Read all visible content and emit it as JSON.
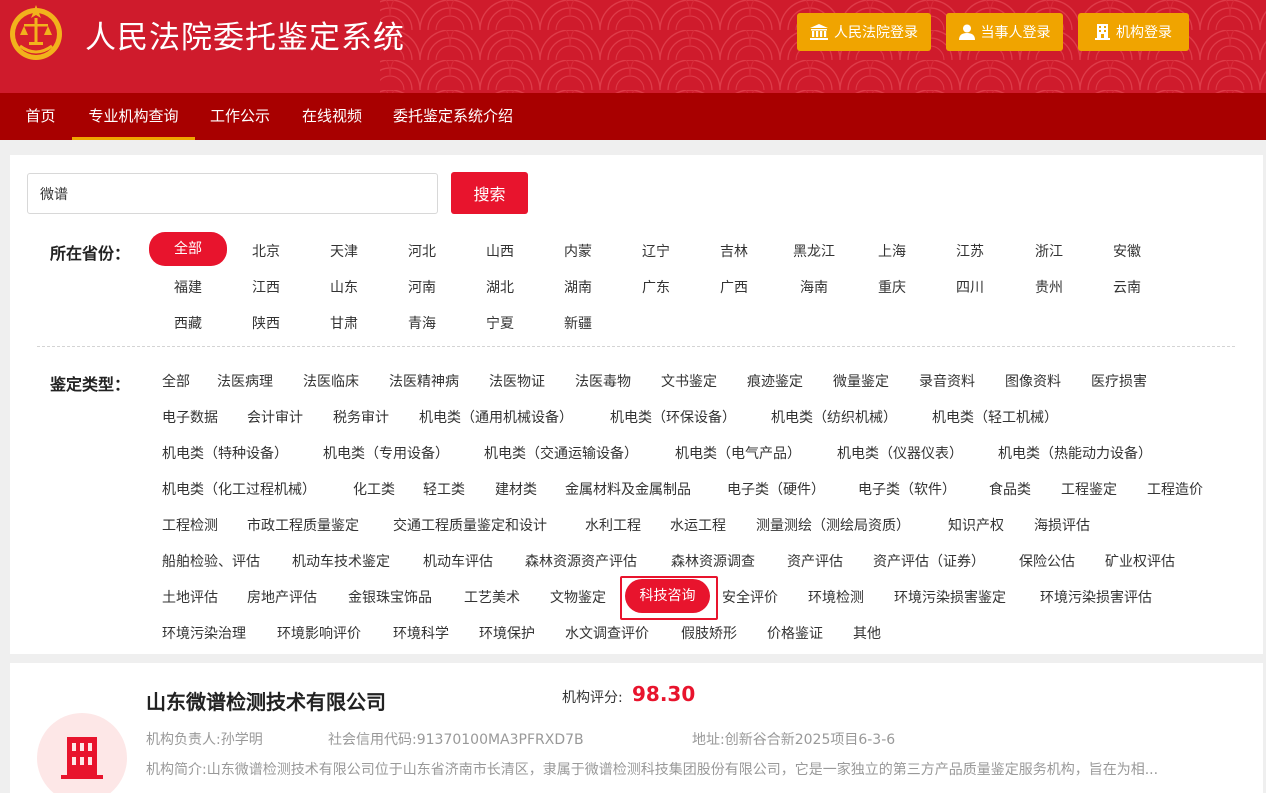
{
  "header": {
    "title": "人民法院委托鉴定系统",
    "buttons": [
      {
        "label": "人民法院登录",
        "icon": "court-building-icon"
      },
      {
        "label": "当事人登录",
        "icon": "person-icon"
      },
      {
        "label": "机构登录",
        "icon": "institution-building-icon"
      }
    ]
  },
  "nav": {
    "items": [
      "首页",
      "专业机构查询",
      "工作公示",
      "在线视频",
      "委托鉴定系统介绍"
    ],
    "active": "专业机构查询"
  },
  "search": {
    "value": "微谱",
    "button_label": "搜索"
  },
  "filters": {
    "province_label": "所在省份：",
    "provinces": [
      [
        "全部",
        "北京",
        "天津",
        "河北",
        "山西",
        "内蒙",
        "辽宁",
        "吉林",
        "黑龙江",
        "上海",
        "江苏",
        "浙江",
        "安徽"
      ],
      [
        "福建",
        "江西",
        "山东",
        "河南",
        "湖北",
        "湖南",
        "广东",
        "广西",
        "海南",
        "重庆",
        "四川",
        "贵州",
        "云南"
      ],
      [
        "西藏",
        "陕西",
        "甘肃",
        "青海",
        "宁夏",
        "新疆"
      ]
    ],
    "province_selected": "全部",
    "type_label": "鉴定类型：",
    "types": [
      [
        "全部",
        "法医病理",
        "法医临床",
        "法医精神病",
        "法医物证",
        "法医毒物",
        "文书鉴定",
        "痕迹鉴定",
        "微量鉴定",
        "录音资料",
        "图像资料",
        "医疗损害"
      ],
      [
        "电子数据",
        "会计审计",
        "税务审计",
        "机电类（通用机械设备）",
        "机电类（环保设备）",
        "机电类（纺织机械）",
        "机电类（轻工机械）"
      ],
      [
        "机电类（特种设备）",
        "机电类（专用设备）",
        "机电类（交通运输设备）",
        "机电类（电气产品）",
        "机电类（仪器仪表）",
        "机电类（热能动力设备）"
      ],
      [
        "机电类（化工过程机械）",
        "化工类",
        "轻工类",
        "建材类",
        "金属材料及金属制品",
        "电子类（硬件）",
        "电子类（软件）",
        "食品类",
        "工程鉴定",
        "工程造价"
      ],
      [
        "工程检测",
        "市政工程质量鉴定",
        "交通工程质量鉴定和设计",
        "水利工程",
        "水运工程",
        "测量测绘（测绘局资质）",
        "知识产权",
        "海损评估"
      ],
      [
        "船舶检验、评估",
        "机动车技术鉴定",
        "机动车评估",
        "森林资源资产评估",
        "森林资源调查",
        "资产评估",
        "资产评估（证券）",
        "保险公估",
        "矿业权评估"
      ],
      [
        "土地评估",
        "房地产评估",
        "金银珠宝饰品",
        "工艺美术",
        "文物鉴定",
        "科技咨询",
        "安全评价",
        "环境检测",
        "环境污染损害鉴定",
        "环境污染损害评估"
      ],
      [
        "环境污染治理",
        "环境影响评价",
        "环境科学",
        "环境保护",
        "水文调查评价",
        "假肢矫形",
        "价格鉴证",
        "其他"
      ]
    ],
    "type_selected": "科技咨询"
  },
  "result": {
    "name": "山东微谱检测技术有限公司",
    "score_label": "机构评分:",
    "score": "98.30",
    "leader": "机构负责人:孙学明",
    "credit_code": "社会信用代码:91370100MA3PFRXD7B",
    "address": "地址:创新谷合新2025项目6-3-6",
    "intro": "机构简介:山东微谱检测技术有限公司位于山东省济南市长清区，隶属于微谱检测科技集团股份有限公司，它是一家独立的第三方产品质量鉴定服务机构，旨在为相..."
  },
  "colors": {
    "header_red": "#cf1b2c",
    "nav_red": "#a80000",
    "accent_red": "#e8142d",
    "gold": "#f0a400"
  }
}
